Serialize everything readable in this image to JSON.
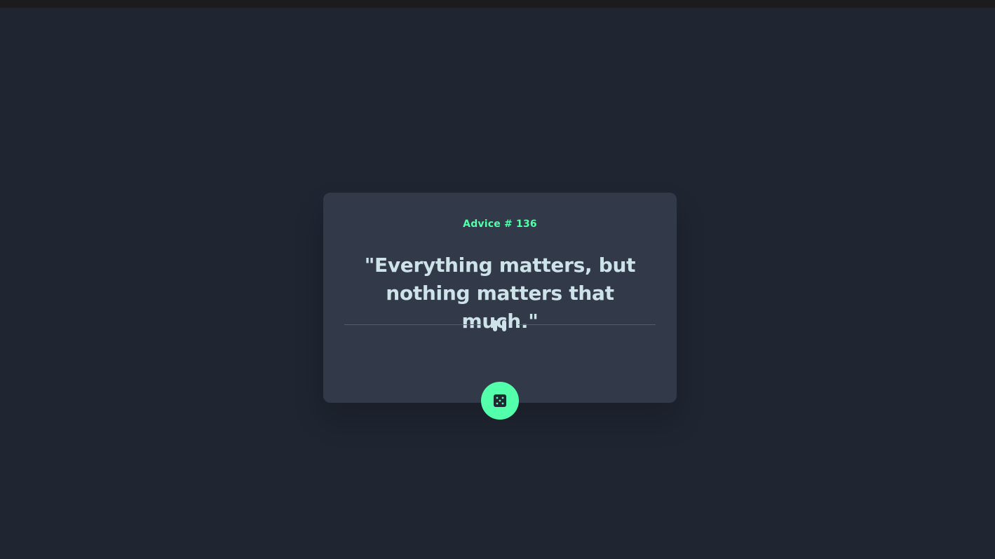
{
  "advice": {
    "id_label": "Advice # 136",
    "quote": "\"Everything matters, but nothing matters that much.\""
  },
  "divider": {
    "icon": "pause-icon"
  },
  "action": {
    "icon": "dice-icon"
  },
  "colors": {
    "background": "#1f2531",
    "card": "#323a4a",
    "accent": "#53ffaa",
    "text": "#cee3e9",
    "divider": "#4f5d74"
  }
}
